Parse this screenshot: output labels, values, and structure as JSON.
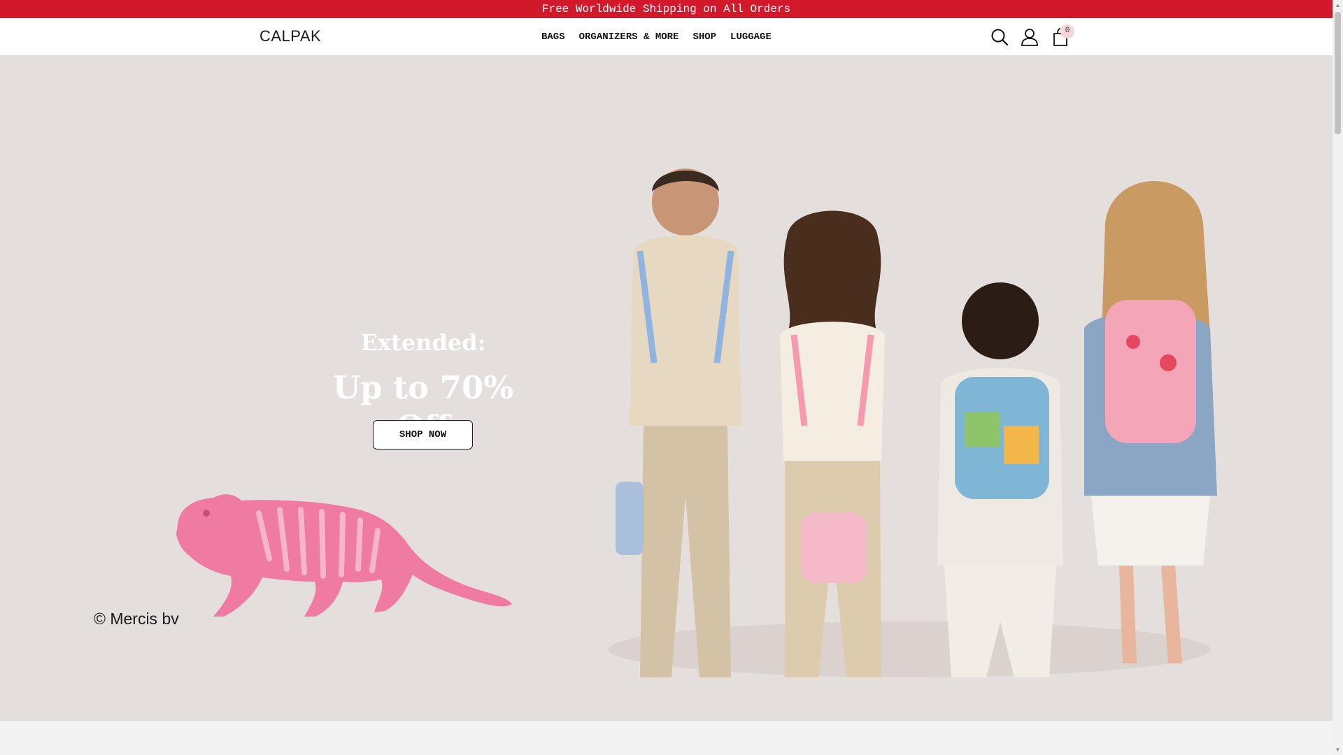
{
  "announcement": "Free Worldwide Shipping on All Orders",
  "brand": "CALPAK",
  "nav": [
    "BAGS",
    "ORGANIZERS & MORE",
    "SHOP",
    "LUGGAGE"
  ],
  "icons": {
    "search": "search-icon",
    "account": "user-icon",
    "cart": "shopping-bag-icon"
  },
  "cart_count": "0",
  "hero": {
    "line1": "Extended:",
    "line2": "Up to 70% Off",
    "cta": "SHOP NOW",
    "copyright": "© Mercis bv"
  },
  "colors": {
    "announcement_bg": "#d2192c",
    "hero_bg": "#e4dedc",
    "tiger_pink": "#ef7aa2",
    "badge_bg": "#f6d5d8"
  }
}
